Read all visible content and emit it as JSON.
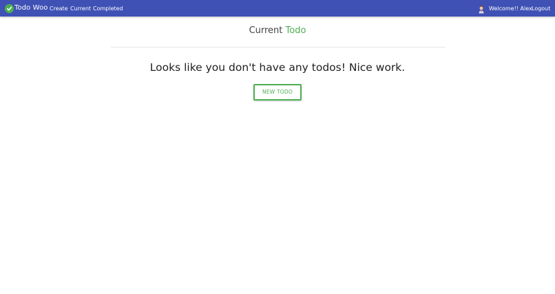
{
  "navbar": {
    "brand": "Todo Woo",
    "links": [
      "Create",
      "Current",
      "Completed"
    ],
    "welcome": "Welcome!! Alex",
    "logout": "Logout",
    "background": "#3f51b5"
  },
  "brand_icon": "check-circle-icon",
  "avatar_icon": "user-avatar-icon",
  "main": {
    "title_prefix": "Current",
    "title_accent": "Todo",
    "empty_message": "Looks like you don't have any todos! Nice work.",
    "new_button": "NEW TODO",
    "accent_color": "#4caf50"
  }
}
